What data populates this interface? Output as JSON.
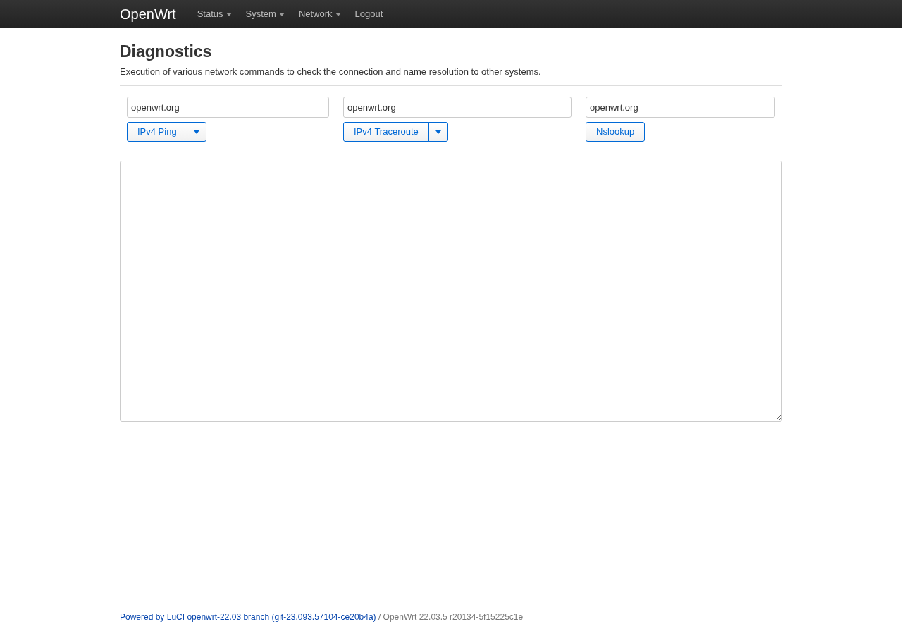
{
  "navbar": {
    "brand": "OpenWrt",
    "menu": [
      {
        "label": "Status",
        "dropdown": true
      },
      {
        "label": "System",
        "dropdown": true
      },
      {
        "label": "Network",
        "dropdown": true
      },
      {
        "label": "Logout",
        "dropdown": false
      }
    ]
  },
  "page": {
    "title": "Diagnostics",
    "description": "Execution of various network commands to check the connection and name resolution to other systems."
  },
  "tools": [
    {
      "value": "openwrt.org",
      "kind": "split",
      "button": "IPv4 Ping"
    },
    {
      "value": "openwrt.org",
      "kind": "split",
      "button": "IPv4 Traceroute"
    },
    {
      "value": "openwrt.org",
      "kind": "plain",
      "button": "Nslookup"
    }
  ],
  "footer": {
    "link": "Powered by LuCI openwrt-22.03 branch (git-23.093.57104-ce20b4a)",
    "text": "/ OpenWrt 22.03.5 r20134-5f15225c1e"
  }
}
